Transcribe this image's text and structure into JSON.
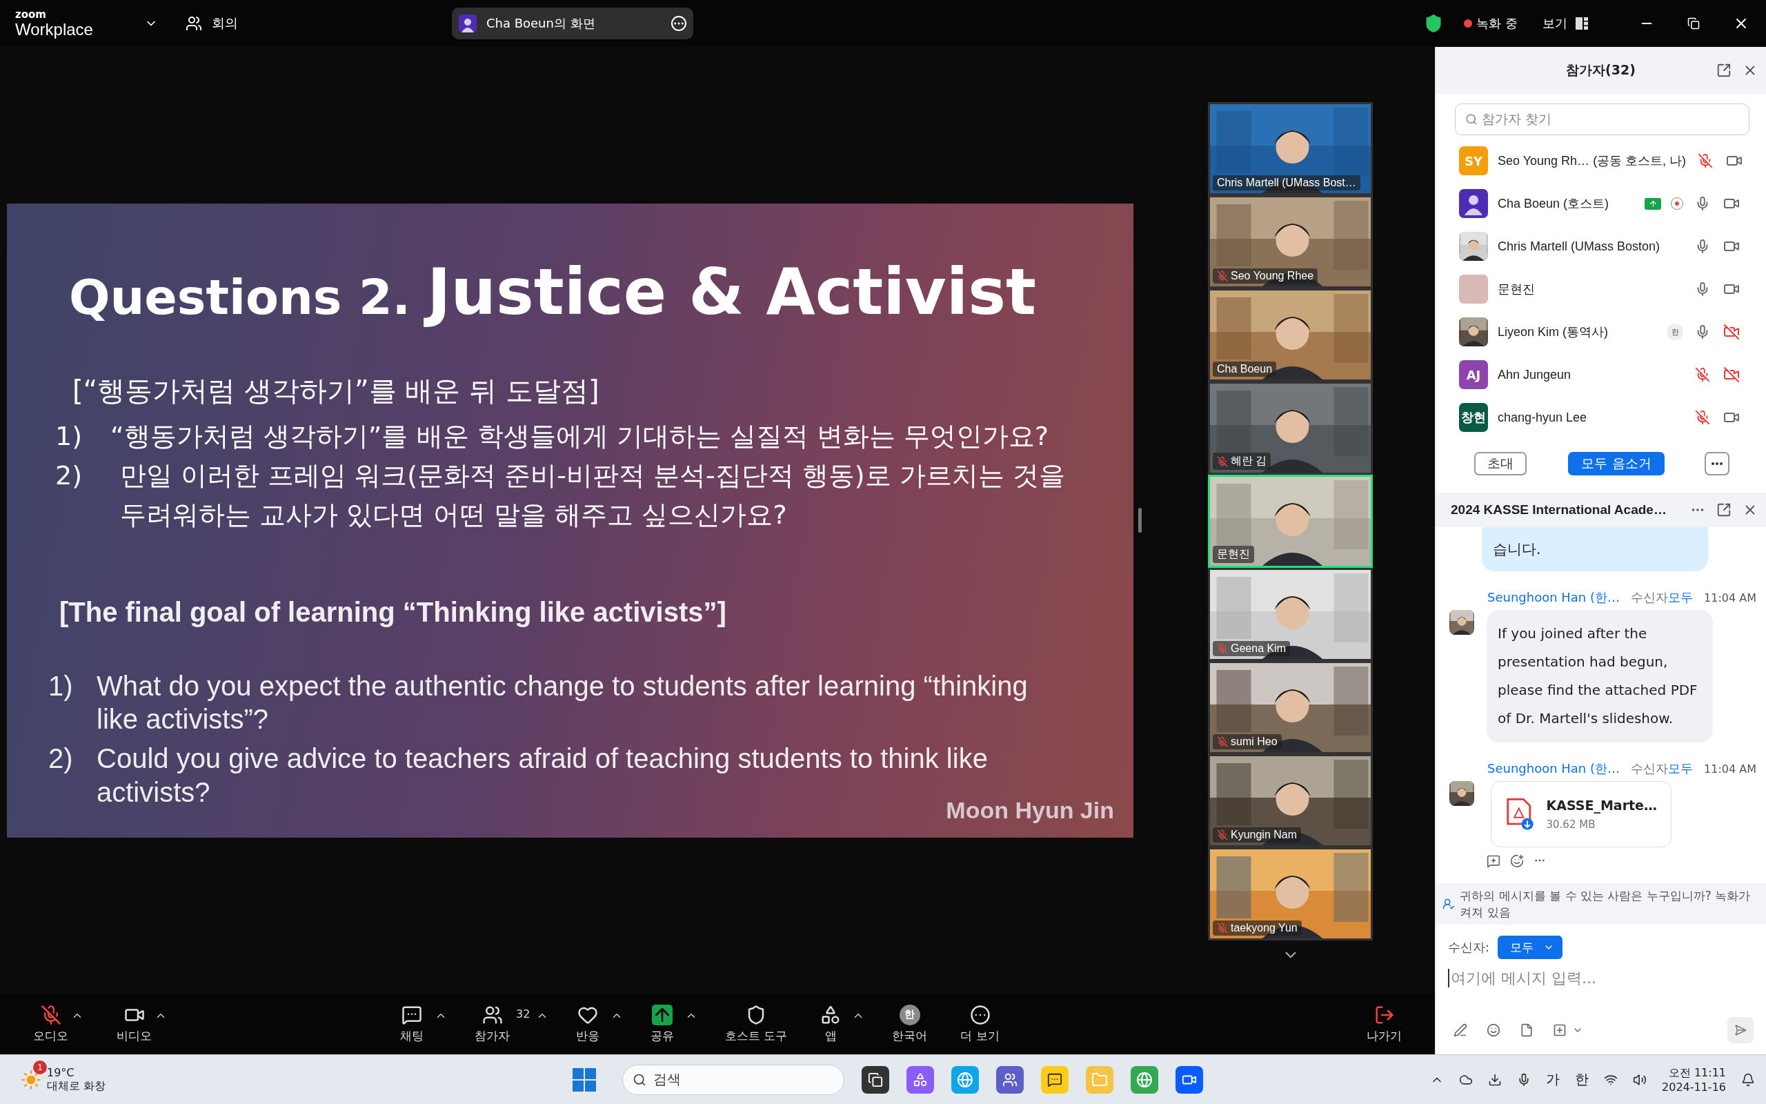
{
  "top_bar": {
    "brand_small": "zoom",
    "brand": "Workplace",
    "meeting_label": "회의",
    "share_title": "Cha Boeun의 화면",
    "recording": "녹화 중",
    "view": "보기"
  },
  "slide": {
    "title_prefix": "Questions 2.",
    "title_main": "Justice & Activist",
    "ko_heading": "[“행동가처럼 생각하기”를 배운 뒤 도달점]",
    "ko_questions": [
      {
        "num": "1)",
        "lines": [
          "“행동가처럼 생각하기”를 배운 학생들에게 기대하는 실질적 변화는 무엇인가요?"
        ]
      },
      {
        "num": "2)",
        "lines": [
          "만일 이러한 프레임 워크(문화적 준비-비판적 분석-집단적 행동)로 가르치는 것을",
          "두려워하는 교사가 있다면 어떤 말을 해주고 싶으신가요?"
        ]
      }
    ],
    "en_heading": "[The final goal of learning “Thinking like activists”]",
    "en_questions": [
      {
        "num": "1)",
        "lines": [
          "What do you expect the authentic change to students after learning “thinking",
          "like activists”?"
        ]
      },
      {
        "num": "2)",
        "lines": [
          "Could you give advice to teachers afraid of teaching students to think like",
          "activists?"
        ]
      }
    ],
    "author": "Moon Hyun Jin"
  },
  "videos": [
    {
      "name": "Chris Martell (UMass Bost…",
      "muted": false,
      "speaking": false
    },
    {
      "name": "Seo Young Rhee",
      "muted": true,
      "speaking": false
    },
    {
      "name": "Cha Boeun",
      "muted": false,
      "speaking": false
    },
    {
      "name": "혜란 김",
      "muted": true,
      "speaking": false
    },
    {
      "name": "문현진",
      "muted": false,
      "speaking": true
    },
    {
      "name": "Geena Kim",
      "muted": true,
      "speaking": false
    },
    {
      "name": "sumi Heo",
      "muted": true,
      "speaking": false
    },
    {
      "name": "Kyungin Nam",
      "muted": true,
      "speaking": false
    },
    {
      "name": "taekyong Yun",
      "muted": true,
      "speaking": false
    }
  ],
  "participants_panel": {
    "title": "참가자(32)",
    "search_placeholder": "참가자 찾기",
    "invite": "초대",
    "mute_all": "모두 음소거"
  },
  "participants": [
    {
      "name": "Seo Young Rh…",
      "role": "(공동 호스트, 나)",
      "avatar": {
        "kind": "initials",
        "text": "SY",
        "color": "#f59e0b"
      },
      "sharing": false,
      "recording": false,
      "mic_muted": true,
      "video_off": false
    },
    {
      "name": "Cha Boeun",
      "role": "(호스트)",
      "avatar": {
        "kind": "silhouette",
        "color": "#4c2db3"
      },
      "sharing": true,
      "recording": true,
      "mic_muted": false,
      "video_off": false
    },
    {
      "name": "Chris Martell (UMass Boston)",
      "sharing": false,
      "recording": false,
      "mic_muted": false,
      "video_off": false
    },
    {
      "name": "문현진",
      "avatar": {
        "kind": "plain",
        "color": "#d9b9b6"
      },
      "sharing": false,
      "recording": false,
      "mic_muted": false,
      "video_off": false
    },
    {
      "name": "Liyeon Kim",
      "role": "(통역사)",
      "language": "한",
      "sharing": false,
      "recording": false,
      "mic_muted": false,
      "video_off": true
    },
    {
      "name": "Ahn Jungeun",
      "avatar": {
        "kind": "initials",
        "text": "AJ",
        "color": "#8e44ad"
      },
      "sharing": false,
      "recording": false,
      "mic_muted": true,
      "video_off": true
    },
    {
      "name": "chang-hyun Lee",
      "avatar": {
        "kind": "initials",
        "text": "창현",
        "color": "#0b5a45"
      },
      "sharing": false,
      "recording": false,
      "mic_muted": true,
      "video_off": false
    }
  ],
  "chat": {
    "title": "2024 KASSE International Acade…",
    "messages": [
      {
        "kind": "mine",
        "text": "습니다."
      },
      {
        "kind": "text",
        "sender": "Seunghoon Han (한…",
        "to_label": "수신자",
        "to": "모두",
        "time": "11:04 AM",
        "text": "If you joined after the presentation had begun, please find the attached PDF of Dr. Martell's slideshow."
      },
      {
        "kind": "file",
        "sender": "Seunghoon Han (한…",
        "to_label": "수신자",
        "to": "모두",
        "time": "11:04 AM",
        "file_name": "KASSE_Marte…",
        "file_size": "30.62 MB"
      }
    ],
    "notice": "귀하의 메시지를 볼 수 있는 사람은 누구입니까? 녹화가 켜져 있음",
    "recipient_label": "수신자:",
    "recipient": "모두",
    "input_placeholder": "여기에 메시지 입력..."
  },
  "toolbar": {
    "audio": {
      "label": "오디오",
      "muted": true
    },
    "video": {
      "label": "비디오"
    },
    "center": [
      {
        "label": "채팅",
        "caret": true
      },
      {
        "label": "참가자",
        "count": "32",
        "caret": true
      },
      {
        "label": "반응",
        "caret": true
      },
      {
        "label": "공유",
        "caret": true
      },
      {
        "label": "호스트 도구",
        "caret": false
      },
      {
        "label": "앱",
        "caret": true
      },
      {
        "label": "한국어",
        "badge": "한",
        "caret": false
      },
      {
        "label": "더 보기",
        "caret": false
      }
    ],
    "leave": "나가기"
  },
  "taskbar": {
    "weather": {
      "badge": "1",
      "temp": "19°C",
      "desc": "대체로 화창"
    },
    "search": "검색",
    "ime1": "가",
    "ime2": "한",
    "time": "오전 11:11",
    "date": "2024-11-16"
  }
}
